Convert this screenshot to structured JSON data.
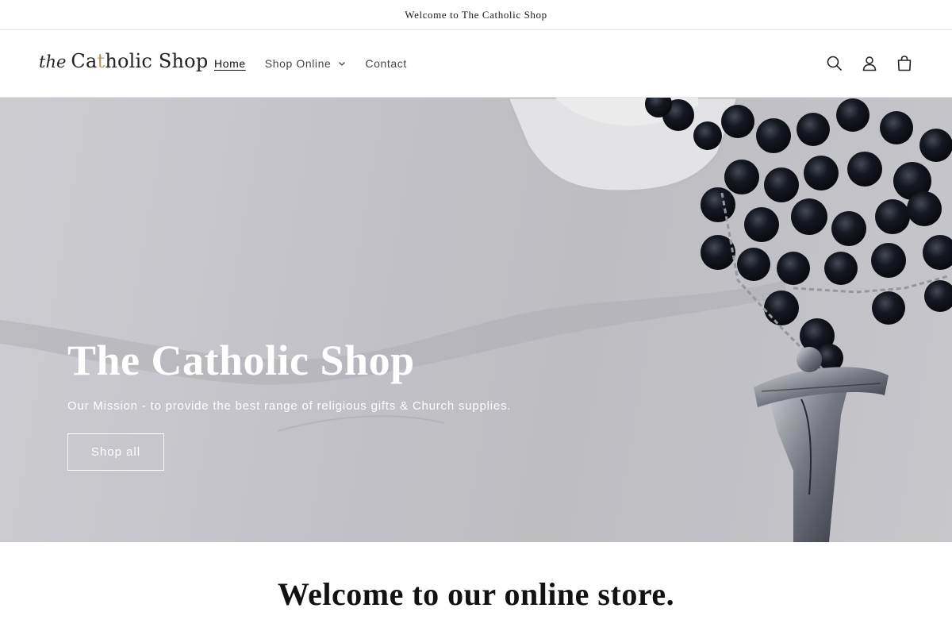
{
  "announcement": {
    "text": "Welcome to The Catholic Shop"
  },
  "header": {
    "logo": {
      "prefix": "the",
      "name_a": "Ca",
      "name_accent": "t",
      "name_b": "holic Shop"
    },
    "nav": [
      {
        "label": "Home",
        "active": true
      },
      {
        "label": "Shop Online",
        "has_dropdown": true
      },
      {
        "label": "Contact"
      }
    ],
    "icons": [
      "search-icon",
      "account-icon",
      "cart-icon"
    ]
  },
  "hero": {
    "title": "The Catholic Shop",
    "subtitle": "Our Mission - to provide the best range of religious gifts & Church supplies.",
    "button_label": "Shop all"
  },
  "welcome": {
    "heading": "Welcome to our online store."
  },
  "colors": {
    "accent": "#b79a61",
    "text": "#121212",
    "border": "#e6e6e6",
    "bead": "#141620"
  }
}
